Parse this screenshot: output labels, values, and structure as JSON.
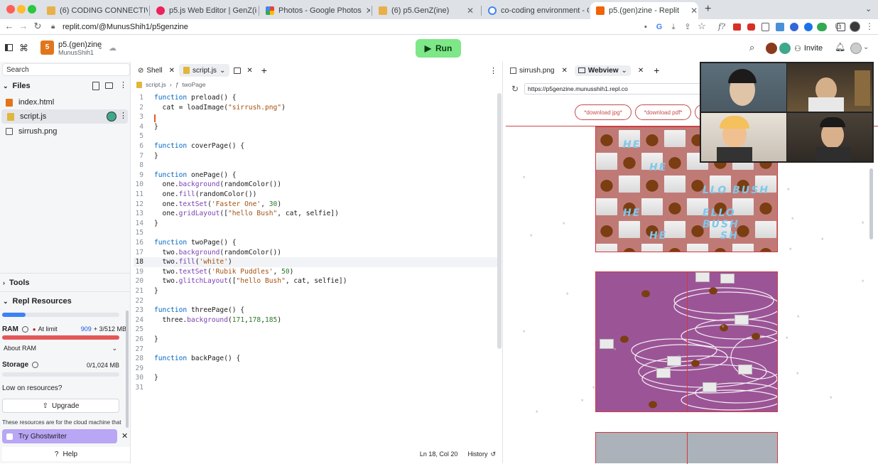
{
  "browser": {
    "tabs": [
      {
        "title": "(6) CODING CONNECTIVITY: A",
        "favicon_color": "#e8b04a"
      },
      {
        "title": "p5.js Web Editor | GenZ(ine) - ..",
        "favicon_color": "#ed225d"
      },
      {
        "title": "Photos - Google Photos",
        "favicon_color": "#4285f4"
      },
      {
        "title": "(6) p5.GenZ(ine)",
        "favicon_color": "#e8b04a"
      },
      {
        "title": "co-coding environment - Goo",
        "favicon_color": "#4285f4"
      },
      {
        "title": "p5.(gen)zine - Replit",
        "favicon_color": "#f26207",
        "active": true
      }
    ],
    "new_tab_label": "+",
    "url": "replit.com/@MunusShih1/p5genzine"
  },
  "replit": {
    "repl_name": "p5.(gen)zine",
    "owner": "MunusShih1",
    "run_label": "Run",
    "invite_label": "Invite",
    "search_placeholder": "Search",
    "files_header": "Files",
    "files": [
      {
        "name": "index.html",
        "icon": "html-icon"
      },
      {
        "name": "script.js",
        "icon": "js-icon",
        "selected": true
      },
      {
        "name": "sirrush.png",
        "icon": "image-icon"
      }
    ],
    "tools_label": "Tools",
    "resources_label": "Repl Resources",
    "cpu_usage_fraction": 0.2,
    "ram_label": "RAM",
    "ram_status": "At limit",
    "ram_used": "909",
    "ram_extra": "+ 3/512 MB",
    "ram_fraction": 1.0,
    "about_ram": "About RAM",
    "storage_label": "Storage",
    "storage_value": "0/1,024 MB",
    "low_resources": "Low on resources?",
    "upgrade_label": "Upgrade",
    "resources_note": "These resources are for the cloud machine that",
    "ghostwriter_label": "Try Ghostwriter",
    "help_label": "Help"
  },
  "editor": {
    "tabs": [
      {
        "label": "Shell"
      },
      {
        "label": "script.js",
        "active": true
      }
    ],
    "breadcrumb_file": "script.js",
    "breadcrumb_fn": "twoPage",
    "lines": [
      "function preload() {",
      "  cat = loadImage(\"sirrush.png\")",
      "",
      "}",
      "",
      "function coverPage() {",
      "}",
      "",
      "function onePage() {",
      "  one.background(randomColor())",
      "  one.fill(randomColor())",
      "  one.textSet('Faster One', 30)",
      "  one.gridLayout([\"hello Bush\", cat, selfie])",
      "}",
      "",
      "function twoPage() {",
      "  two.background(randomColor())",
      "  two.fill('white')",
      "  two.textSet('Rubik Puddles', 50)",
      "  two.glitchLayout([\"hello Bush\", cat, selfie])",
      "}",
      "",
      "function threePage() {",
      "  three.background(171,178,185)",
      "",
      "}",
      "",
      "function backPage() {",
      "",
      "}",
      ""
    ],
    "current_line": 18,
    "status": "Ln 18, Col 20",
    "history_label": "History"
  },
  "preview": {
    "tabs": [
      {
        "label": "sirrush.png"
      },
      {
        "label": "Webview",
        "active": true
      }
    ],
    "url": "https://p5genzine.munusshih1.repl.co",
    "buttons": [
      "*download jpg*",
      "*download pdf*"
    ],
    "zine_text": [
      "HE",
      "SH",
      "HE",
      "LLO BUSH",
      "HE",
      "ELLO BUSH",
      "HE",
      "SH"
    ],
    "page_colors": {
      "one": "#c07a76",
      "two": "#9b5597",
      "three": "#abb2b9"
    }
  },
  "colors": {
    "accent_run": "#7ee787",
    "ram_bar": "#e45757",
    "cpu_bar": "#3b82f6",
    "ghostwriter": "#b9a6f5"
  }
}
